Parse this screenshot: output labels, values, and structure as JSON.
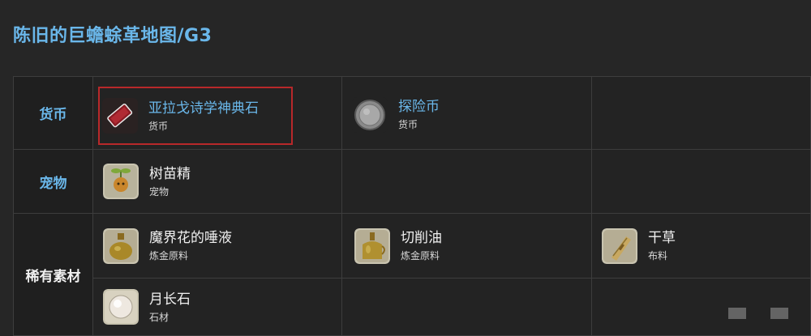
{
  "title": "陈旧的巨蟾蜍革地图/G3",
  "rows": {
    "currency": {
      "category": "货币",
      "items": [
        {
          "name": "亚拉戈诗学神典石",
          "type": "货币",
          "icon": "allagan-poetics-tomestone-icon"
        },
        {
          "name": "探险币",
          "type": "货币",
          "icon": "venture-coin-icon"
        }
      ]
    },
    "pet": {
      "category": "宠物",
      "items": [
        {
          "name": "树苗精",
          "type": "宠物",
          "icon": "sapling-minion-icon"
        }
      ]
    },
    "rare": {
      "category": "稀有素材",
      "items": [
        {
          "name": "魔界花的唾液",
          "type": "炼金原料",
          "icon": "flask-icon"
        },
        {
          "name": "切削油",
          "type": "炼金原料",
          "icon": "oil-jug-icon"
        },
        {
          "name": "干草",
          "type": "布料",
          "icon": "hay-bundle-icon"
        },
        {
          "name": "月长石",
          "type": "石材",
          "icon": "moonstone-pearl-icon"
        }
      ]
    }
  },
  "colors": {
    "accent": "#6ab7ea",
    "highlight": "#b8282a",
    "background": "#262626"
  }
}
